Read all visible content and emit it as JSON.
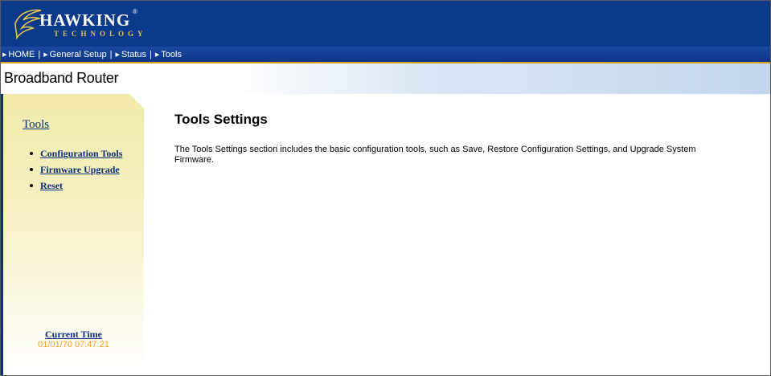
{
  "header": {
    "logo_text": "HAWKING",
    "logo_subtext": "TECHNOLOGY",
    "logo_reg": "®"
  },
  "nav": {
    "items": [
      {
        "label": "HOME",
        "icon": "arrow-right-icon"
      },
      {
        "label": "General Setup",
        "icon": "arrow-right-icon"
      },
      {
        "label": "Status",
        "icon": "arrow-right-icon"
      },
      {
        "label": "Tools",
        "icon": "arrow-right-icon"
      }
    ],
    "separator": "|"
  },
  "product": {
    "title": "Broadband Router"
  },
  "sidebar": {
    "title": "Tools",
    "items": [
      {
        "label": "Configuration Tools"
      },
      {
        "label": "Firmware Upgrade"
      },
      {
        "label": "Reset"
      }
    ],
    "current_time_label": "Current Time",
    "current_time_value": "01/01/70 07:47:21"
  },
  "main": {
    "title": "Tools Settings",
    "description": "The Tools Settings section includes the basic configuration tools, such as Save, Restore Configuration Settings, and Upgrade System Firmware."
  },
  "colors": {
    "header_blue": "#0b3a8a",
    "nav_underline": "#d9a01e",
    "link_blue": "#0b2f7a",
    "time_orange": "#f0a020",
    "sidebar_yellow": "#f1eaaa"
  }
}
